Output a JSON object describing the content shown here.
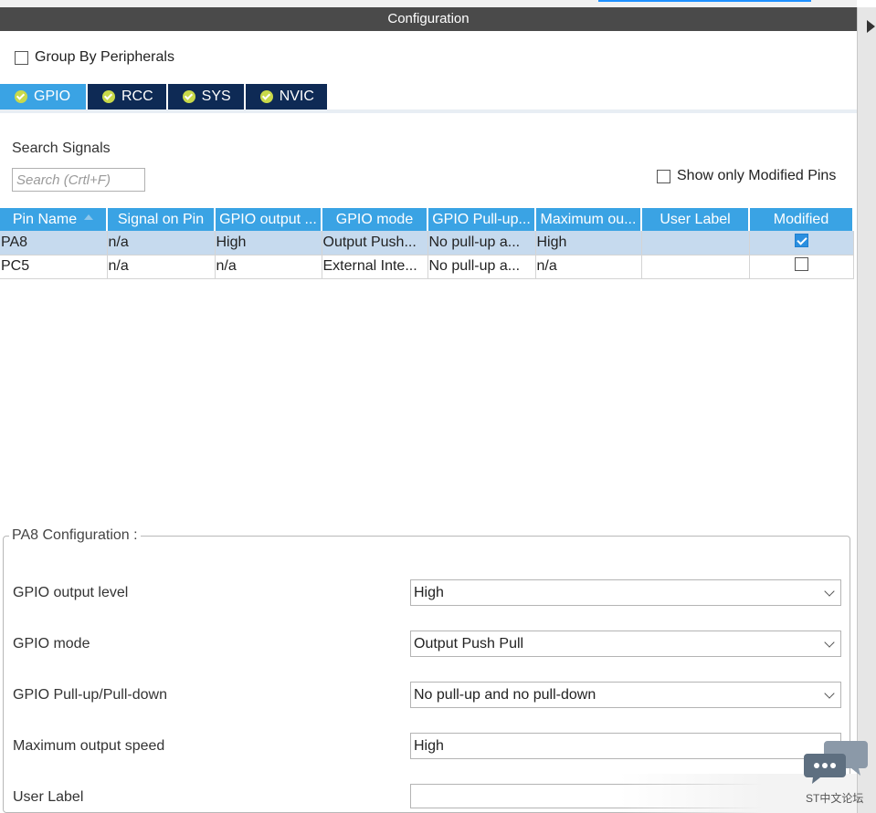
{
  "window": {
    "title": "Configuration"
  },
  "options": {
    "group_by_label": "Group By Peripherals",
    "group_by_checked": false
  },
  "tabs": [
    {
      "label": "GPIO",
      "active": true
    },
    {
      "label": "RCC",
      "active": false
    },
    {
      "label": "SYS",
      "active": false
    },
    {
      "label": "NVIC",
      "active": false
    }
  ],
  "search": {
    "label": "Search Signals",
    "placeholder": "Search (Crtl+F)",
    "value": ""
  },
  "show_modified": {
    "label": "Show only Modified Pins",
    "checked": false
  },
  "table": {
    "columns": [
      "Pin Name",
      "Signal on Pin",
      "GPIO output ...",
      "GPIO mode",
      "GPIO Pull-up...",
      "Maximum ou...",
      "User Label",
      "Modified"
    ],
    "rows": [
      {
        "pin": "PA8",
        "signal": "n/a",
        "output": "High",
        "mode": "Output Push...",
        "pull": "No pull-up a...",
        "speed": "High",
        "user_label": "",
        "modified": true,
        "selected": true
      },
      {
        "pin": "PC5",
        "signal": "n/a",
        "output": "n/a",
        "mode": "External Inte...",
        "pull": "No pull-up a...",
        "speed": "n/a",
        "user_label": "",
        "modified": false,
        "selected": false
      }
    ]
  },
  "pin_config": {
    "legend": "PA8 Configuration :",
    "fields": {
      "output_level": {
        "label": "GPIO output level",
        "value": "High"
      },
      "mode": {
        "label": "GPIO mode",
        "value": "Output Push Pull"
      },
      "pull": {
        "label": "GPIO Pull-up/Pull-down",
        "value": "No pull-up and no pull-down"
      },
      "speed": {
        "label": "Maximum output speed",
        "value": "High"
      },
      "user_label": {
        "label": "User Label",
        "value": ""
      }
    }
  },
  "watermark": {
    "text": "ST中文论坛"
  },
  "colors": {
    "accent": "#3aa3e4",
    "tab_dark": "#0e2a55",
    "titlebar": "#4a4a4a",
    "selected_row": "#c6daee"
  }
}
